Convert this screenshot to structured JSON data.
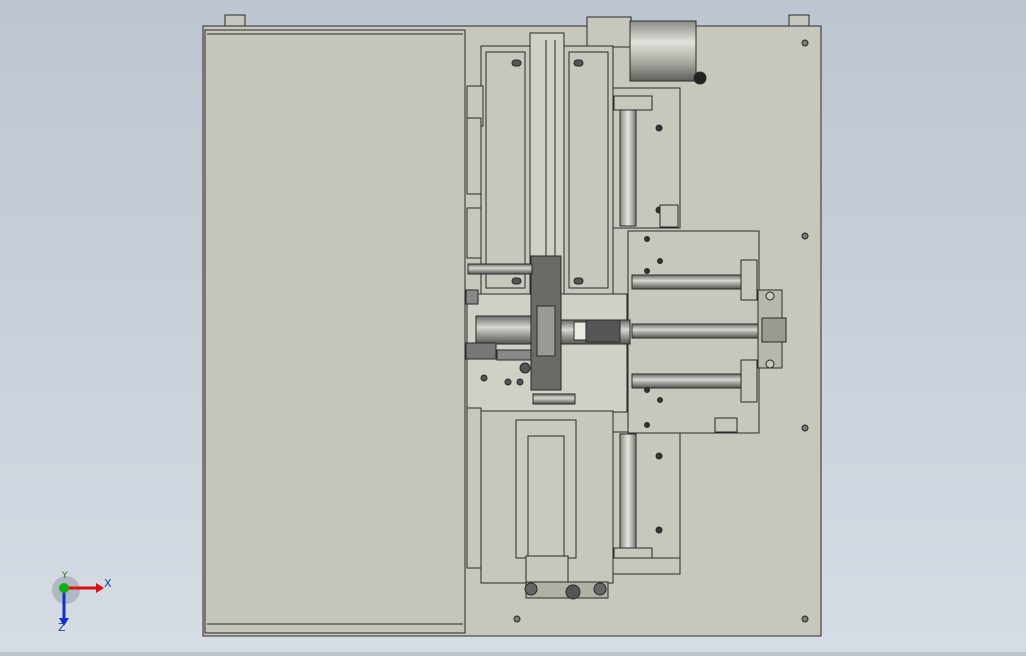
{
  "viewport": {
    "background_top": "#bcc5d0",
    "background_bottom": "#d6dce4",
    "model_fill": "#c6c7bd",
    "model_stroke": "#2a2a2a"
  },
  "triad": {
    "x_label": "X",
    "y_label": "Y",
    "z_label": "Z",
    "x_color": "#e01010",
    "y_color": "#10b010",
    "z_color": "#1030d0"
  }
}
